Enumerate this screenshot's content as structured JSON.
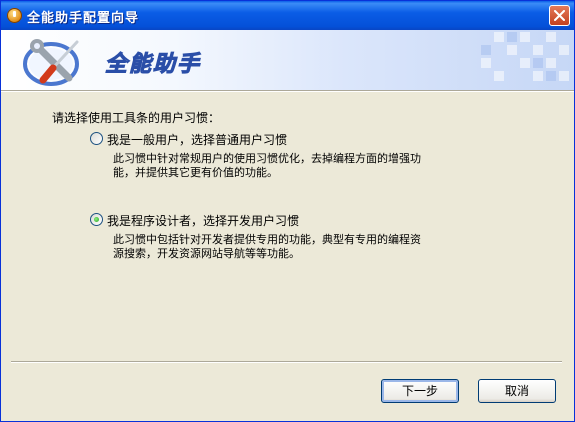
{
  "window": {
    "title": "全能助手配置向导",
    "icon": "app-info-icon",
    "close": "close-icon"
  },
  "banner": {
    "title": "全能助手",
    "logo": "tools-wrench-screwdriver-icon"
  },
  "main": {
    "prompt": "请选择使用工具条的用户习惯：",
    "options": [
      {
        "label": "我是一般用户，选择普通用户习惯",
        "description": "此习惯中针对常规用户的使用习惯优化，去掉编程方面的增强功能，并提供其它更有价值的功能。",
        "selected": false
      },
      {
        "label": "我是程序设计者，选择开发用户习惯",
        "description": "此习惯中包括针对开发者提供专用的功能，典型有专用的编程资源搜索，开发资源网站导航等等功能。",
        "selected": true
      }
    ]
  },
  "footer": {
    "next_label": "下一步",
    "cancel_label": "取消"
  },
  "colors": {
    "titlebar": "#0450d8",
    "window_bg": "#ece9d8",
    "radio_dot": "#21a121"
  }
}
